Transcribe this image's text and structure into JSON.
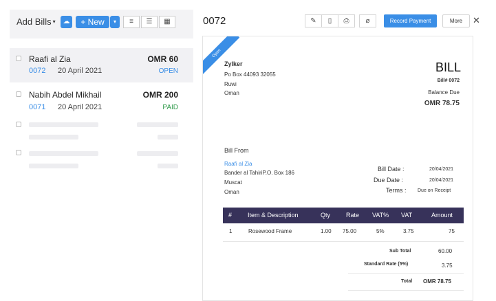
{
  "left": {
    "title": "Add Bills",
    "new_label": "+ New",
    "bills": [
      {
        "vendor": "Raafi al Zia",
        "amount": "OMR 60",
        "number": "0072",
        "date": "20 April 2021",
        "status": "OPEN"
      },
      {
        "vendor": "Nabih Abdel Mikhail",
        "amount": "OMR 200",
        "number": "0071",
        "date": "20 April 2021",
        "status": "PAID"
      }
    ]
  },
  "right": {
    "title": "0072",
    "record_payment": "Record Payment",
    "more": "More"
  },
  "doc": {
    "ribbon": "Open",
    "company": "Zylker",
    "address1": "Po Box 44093 32055",
    "address2": "Ruwi",
    "address3": "Oman",
    "heading": "BILL",
    "bill_no": "Bill# 0072",
    "balance_label": "Balance Due",
    "balance": "OMR 78.75",
    "bill_from_label": "Bill From",
    "vendor": "Raafi al Zia",
    "vendor_addr1": "Bander al TahiriP.O. Box 186",
    "vendor_addr2": "Muscat",
    "vendor_addr3": "Oman",
    "bill_date_label": "Bill Date :",
    "bill_date": "20/04/2021",
    "due_date_label": "Due Date :",
    "due_date": "20/04/2021",
    "terms_label": "Terms :",
    "terms": "Due on Receipt",
    "table": {
      "headers": [
        "#",
        "Item & Description",
        "Qty",
        "Rate",
        "VAT%",
        "VAT",
        "Amount"
      ],
      "rows": [
        [
          "1",
          "Rosewood Frame",
          "1.00",
          "75.00",
          "5%",
          "3.75",
          "75"
        ]
      ]
    },
    "sub_total_label": "Sub Total",
    "sub_total": "60.00",
    "std_rate_label": "Standard Rate (5%)",
    "std_rate": "3.75",
    "total_label": "Total",
    "total": "OMR 78.75"
  },
  "colors": {
    "accent": "#3a8ee6",
    "table_header": "#37325a",
    "paid": "#2f9a4a"
  },
  "icons": [
    "chevron-down-icon",
    "cloud-icon",
    "list-view-icon",
    "detail-view-icon",
    "calendar-icon",
    "pencil-icon",
    "pdf-icon",
    "printer-icon",
    "attachment-icon",
    "close-icon"
  ]
}
